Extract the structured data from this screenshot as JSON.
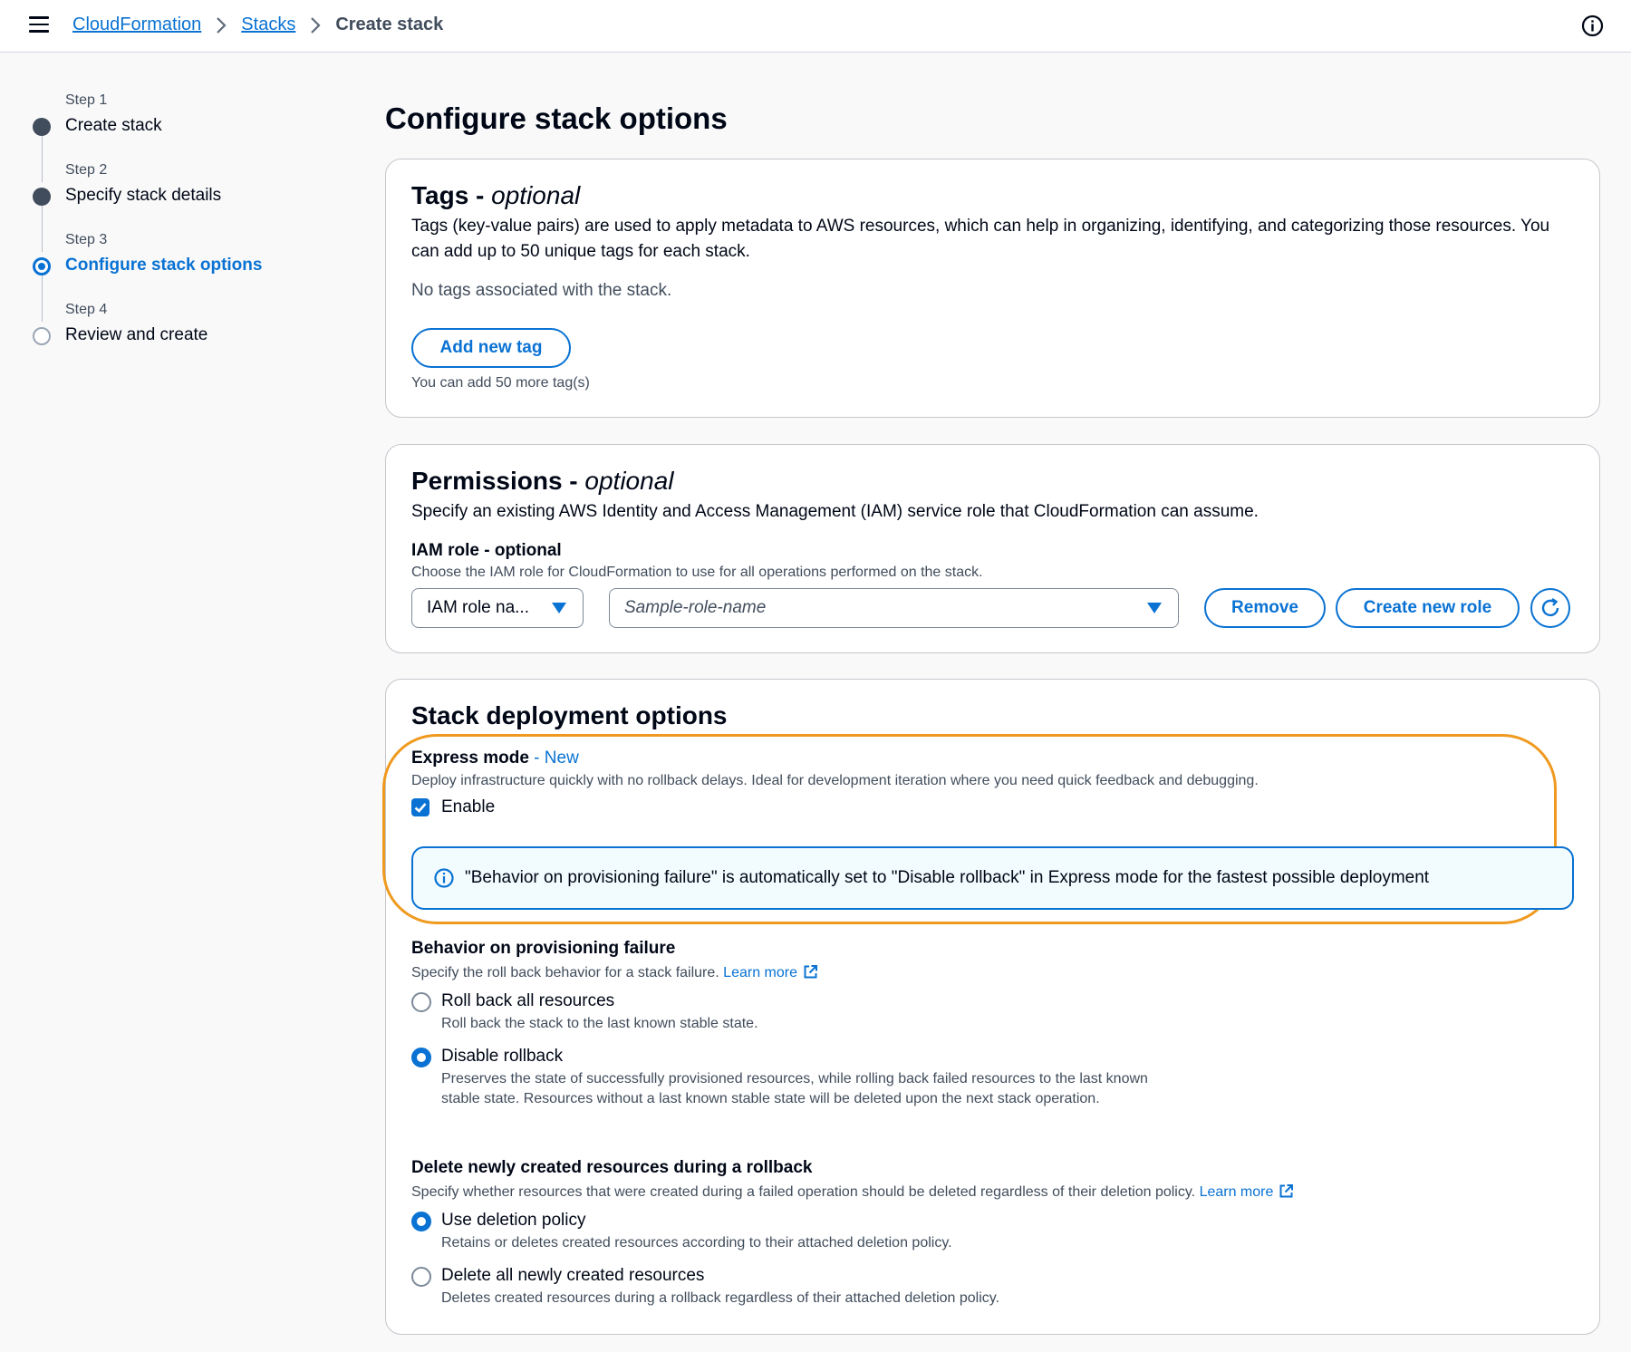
{
  "topbar": {
    "breadcrumb": [
      "CloudFormation",
      "Stacks",
      "Create stack"
    ]
  },
  "steps": [
    {
      "num": "Step 1",
      "label": "Create stack",
      "state": "done"
    },
    {
      "num": "Step 2",
      "label": "Specify stack details",
      "state": "done"
    },
    {
      "num": "Step 3",
      "label": "Configure stack options",
      "state": "current"
    },
    {
      "num": "Step 4",
      "label": "Review and create",
      "state": "future"
    }
  ],
  "page_title": "Configure stack options",
  "tags": {
    "title": "Tags - ",
    "title_suffix": "optional",
    "description": "Tags (key-value pairs) are used to apply metadata to AWS resources, which can help in organizing, identifying, and categorizing those resources. You can add up to 50 unique tags for each stack.",
    "empty": "No tags associated with the stack.",
    "add_button": "Add new tag",
    "hint": "You can add 50 more tag(s)"
  },
  "permissions": {
    "title": "Permissions - ",
    "title_suffix": "optional",
    "description": "Specify an existing AWS Identity and Access Management (IAM) service role that CloudFormation can assume.",
    "iam_label": "IAM role - optional",
    "iam_hint": "Choose the IAM role for CloudFormation to use for all operations performed on the stack.",
    "type_select": "IAM role na...",
    "role_placeholder": "Sample-role-name",
    "remove_button": "Remove",
    "create_button": "Create new role"
  },
  "deployment": {
    "title": "Stack deployment options",
    "express_label": "Express mode",
    "express_badge": " - New",
    "express_desc": "Deploy infrastructure quickly with no rollback delays. Ideal for development iteration where you need quick feedback and debugging.",
    "enable_label": "Enable",
    "enable_checked": true,
    "info_text": "\"Behavior on provisioning failure\" is automatically set to \"Disable rollback\" in Express mode for the fastest possible deployment",
    "failure_label": "Behavior on provisioning failure",
    "failure_desc": "Specify the roll back behavior for a stack failure.",
    "learn_more": "Learn more",
    "rollback_all": "Roll back all resources",
    "rollback_all_desc": "Roll back the stack to the last known stable state.",
    "disable_rollback": "Disable rollback",
    "disable_rollback_desc": "Preserves the state of successfully provisioned resources, while rolling back failed resources to the last known stable state. Resources without a last known stable state will be deleted upon the next stack operation.",
    "delete_label": "Delete newly created resources during a rollback",
    "delete_desc": "Specify whether resources that were created during a failed operation should be deleted regardless of their deletion policy.",
    "use_policy": "Use deletion policy",
    "use_policy_desc": "Retains or deletes created resources according to their attached deletion policy.",
    "delete_all": "Delete all newly created resources",
    "delete_all_desc": "Deletes created resources during a rollback regardless of their attached deletion policy."
  },
  "colors": {
    "accent": "#0972d3",
    "highlight": "#ef9a1f",
    "info_bg": "#f2fbfe"
  }
}
